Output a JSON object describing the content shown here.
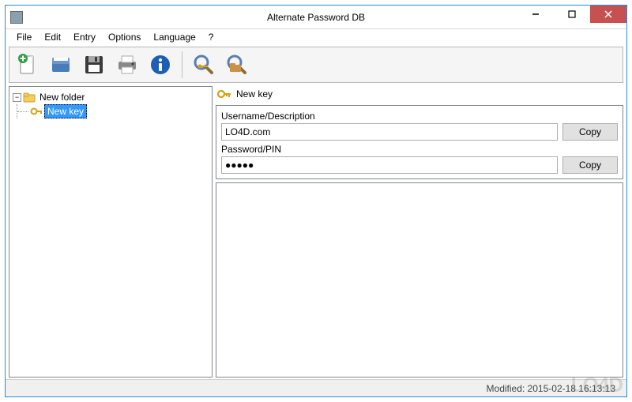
{
  "window": {
    "title": "Alternate Password DB"
  },
  "menu": {
    "file": "File",
    "edit": "Edit",
    "entry": "Entry",
    "options": "Options",
    "language": "Language",
    "help": "?"
  },
  "toolbar": {
    "icons": [
      "new-doc",
      "open",
      "save",
      "print",
      "info",
      "sep",
      "find-key",
      "find-folder"
    ]
  },
  "tree": {
    "root_label": "New folder",
    "child_label": "New key"
  },
  "detail": {
    "header_label": "New key",
    "username_label": "Username/Description",
    "username_value": "LO4D.com",
    "password_label": "Password/PIN",
    "password_value": "●●●●●",
    "copy_label": "Copy"
  },
  "status": {
    "modified": "Modified: 2015-02-18 16:13:13"
  },
  "watermark": "LO4D"
}
